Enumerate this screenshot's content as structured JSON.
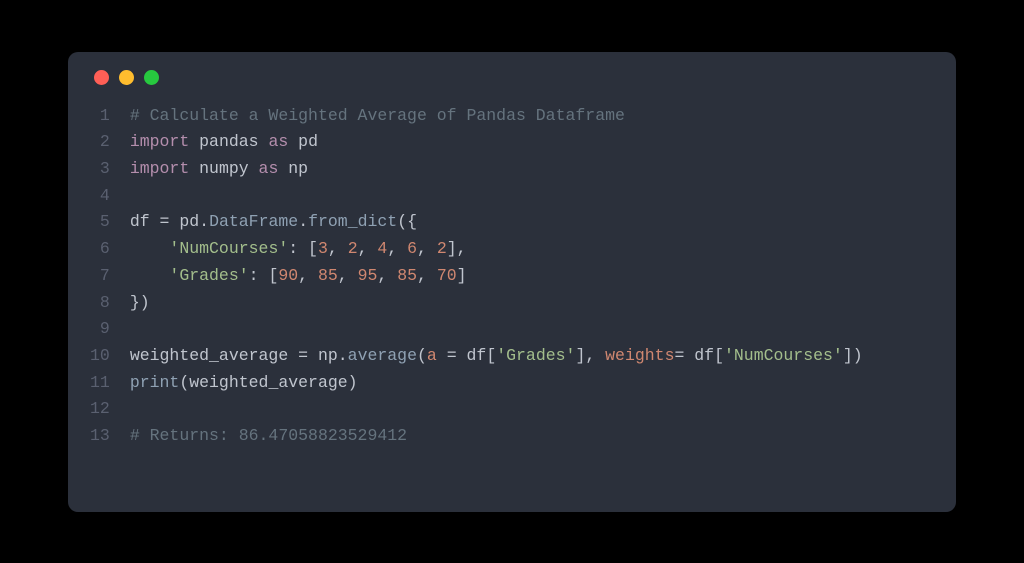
{
  "window": {
    "buttons": {
      "close": "close",
      "minimize": "minimize",
      "maximize": "maximize"
    }
  },
  "code": {
    "gutter": [
      "1",
      "2",
      "3",
      "4",
      "5",
      "6",
      "7",
      "8",
      "9",
      "10",
      "11",
      "12",
      "13"
    ],
    "lines": [
      [
        {
          "c": "tok-comment",
          "t": "# Calculate a Weighted Average of Pandas Dataframe"
        }
      ],
      [
        {
          "c": "tok-keyword",
          "t": "import"
        },
        {
          "c": "tok-module",
          "t": " pandas "
        },
        {
          "c": "tok-keyword",
          "t": "as"
        },
        {
          "c": "tok-module",
          "t": " pd"
        }
      ],
      [
        {
          "c": "tok-keyword",
          "t": "import"
        },
        {
          "c": "tok-module",
          "t": " numpy "
        },
        {
          "c": "tok-keyword",
          "t": "as"
        },
        {
          "c": "tok-module",
          "t": " np"
        }
      ],
      [
        {
          "c": "tok-punct",
          "t": ""
        }
      ],
      [
        {
          "c": "tok-variable",
          "t": "df "
        },
        {
          "c": "tok-operator",
          "t": "="
        },
        {
          "c": "tok-variable",
          "t": " pd"
        },
        {
          "c": "tok-punct",
          "t": "."
        },
        {
          "c": "tok-member",
          "t": "DataFrame"
        },
        {
          "c": "tok-punct",
          "t": "."
        },
        {
          "c": "tok-member",
          "t": "from_dict"
        },
        {
          "c": "tok-punct",
          "t": "({"
        }
      ],
      [
        {
          "c": "tok-punct",
          "t": "    "
        },
        {
          "c": "tok-string",
          "t": "'NumCourses'"
        },
        {
          "c": "tok-punct",
          "t": ": ["
        },
        {
          "c": "tok-number",
          "t": "3"
        },
        {
          "c": "tok-punct",
          "t": ", "
        },
        {
          "c": "tok-number",
          "t": "2"
        },
        {
          "c": "tok-punct",
          "t": ", "
        },
        {
          "c": "tok-number",
          "t": "4"
        },
        {
          "c": "tok-punct",
          "t": ", "
        },
        {
          "c": "tok-number",
          "t": "6"
        },
        {
          "c": "tok-punct",
          "t": ", "
        },
        {
          "c": "tok-number",
          "t": "2"
        },
        {
          "c": "tok-punct",
          "t": "],"
        }
      ],
      [
        {
          "c": "tok-punct",
          "t": "    "
        },
        {
          "c": "tok-string",
          "t": "'Grades'"
        },
        {
          "c": "tok-punct",
          "t": ": ["
        },
        {
          "c": "tok-number",
          "t": "90"
        },
        {
          "c": "tok-punct",
          "t": ", "
        },
        {
          "c": "tok-number",
          "t": "85"
        },
        {
          "c": "tok-punct",
          "t": ", "
        },
        {
          "c": "tok-number",
          "t": "95"
        },
        {
          "c": "tok-punct",
          "t": ", "
        },
        {
          "c": "tok-number",
          "t": "85"
        },
        {
          "c": "tok-punct",
          "t": ", "
        },
        {
          "c": "tok-number",
          "t": "70"
        },
        {
          "c": "tok-punct",
          "t": "]"
        }
      ],
      [
        {
          "c": "tok-punct",
          "t": "})"
        }
      ],
      [
        {
          "c": "tok-punct",
          "t": ""
        }
      ],
      [
        {
          "c": "tok-variable",
          "t": "weighted_average "
        },
        {
          "c": "tok-operator",
          "t": "="
        },
        {
          "c": "tok-variable",
          "t": " np"
        },
        {
          "c": "tok-punct",
          "t": "."
        },
        {
          "c": "tok-member",
          "t": "average"
        },
        {
          "c": "tok-punct",
          "t": "("
        },
        {
          "c": "tok-param",
          "t": "a"
        },
        {
          "c": "tok-punct",
          "t": " "
        },
        {
          "c": "tok-operator",
          "t": "="
        },
        {
          "c": "tok-punct",
          "t": " df["
        },
        {
          "c": "tok-string",
          "t": "'Grades'"
        },
        {
          "c": "tok-punct",
          "t": "], "
        },
        {
          "c": "tok-param",
          "t": "weights"
        },
        {
          "c": "tok-operator",
          "t": "="
        },
        {
          "c": "tok-punct",
          "t": " df["
        },
        {
          "c": "tok-string",
          "t": "'NumCourses'"
        },
        {
          "c": "tok-punct",
          "t": "])"
        }
      ],
      [
        {
          "c": "tok-builtin",
          "t": "print"
        },
        {
          "c": "tok-punct",
          "t": "(weighted_average)"
        }
      ],
      [
        {
          "c": "tok-punct",
          "t": ""
        }
      ],
      [
        {
          "c": "tok-comment",
          "t": "# Returns: 86.47058823529412"
        }
      ]
    ]
  }
}
